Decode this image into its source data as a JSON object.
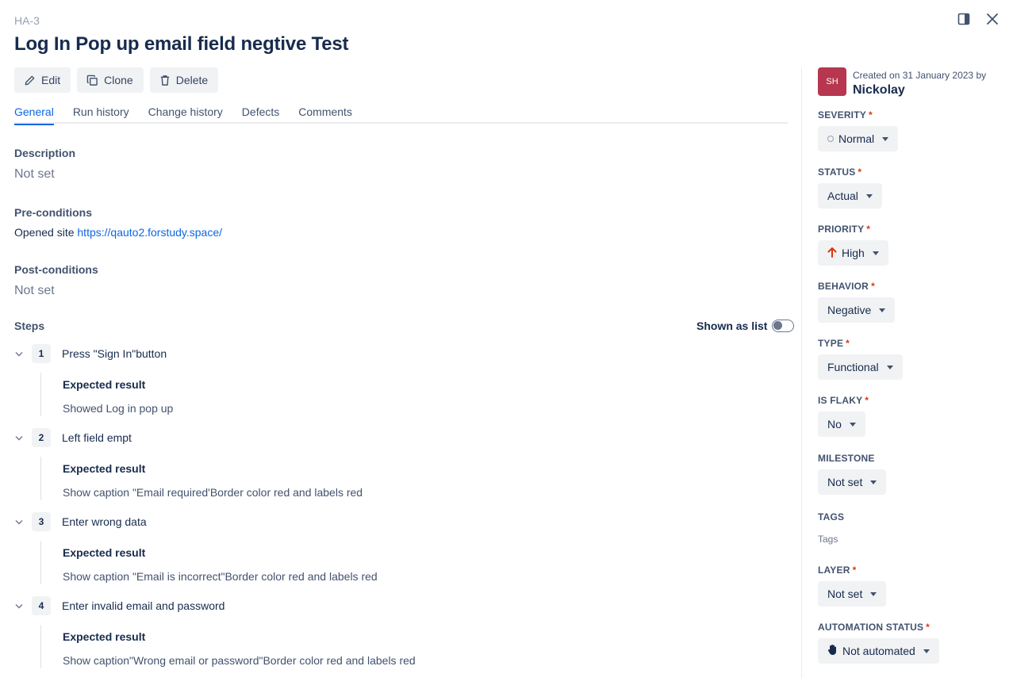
{
  "header": {
    "case_id": "HA-3",
    "title": "Log In Pop up email field negtive Test",
    "icons": [
      "panel-toggle-icon",
      "close-icon"
    ]
  },
  "toolbar": {
    "edit_label": "Edit",
    "clone_label": "Clone",
    "delete_label": "Delete"
  },
  "tabs": [
    {
      "label": "General",
      "active": true
    },
    {
      "label": "Run history",
      "active": false
    },
    {
      "label": "Change history",
      "active": false
    },
    {
      "label": "Defects",
      "active": false
    },
    {
      "label": "Comments",
      "active": false
    }
  ],
  "general": {
    "description_label": "Description",
    "description_value": "Not set",
    "preconditions_label": "Pre-conditions",
    "preconditions_text": "Opened site",
    "preconditions_link": "https://qauto2.forstudy.space/",
    "postconditions_label": "Post-conditions",
    "postconditions_value": "Not set",
    "steps_label": "Steps",
    "shown_as_list_label": "Shown as list",
    "shown_as_list_on": false
  },
  "steps": [
    {
      "number": "1",
      "action": "Press \"Sign In\"button",
      "expected_label": "Expected result",
      "expected": "Showed Log in pop up"
    },
    {
      "number": "2",
      "action": "Left field empt",
      "expected_label": "Expected result",
      "expected": "Show caption \"Email required'Border color red and labels red"
    },
    {
      "number": "3",
      "action": "Enter wrong data",
      "expected_label": "Expected result",
      "expected": "Show caption \"Email is incorrect\"Border color red and labels red"
    },
    {
      "number": "4",
      "action": "Enter invalid email and password",
      "expected_label": "Expected result",
      "expected": "Show caption\"Wrong email or password\"Border color red and labels red"
    }
  ],
  "sidebar": {
    "avatar_initials": "SH",
    "avatar_color": "#b6374f",
    "created_text": "Created on 31 January 2023 by",
    "created_by": "Nickolay",
    "severity": {
      "label": "Severity",
      "required": "*",
      "value": "Normal"
    },
    "status": {
      "label": "Status",
      "required": "*",
      "value": "Actual"
    },
    "priority": {
      "label": "Priority",
      "required": "*",
      "value": "High",
      "icon": "arrow-up-icon",
      "icon_color": "#de350b"
    },
    "behavior": {
      "label": "Behavior",
      "required": "*",
      "value": "Negative"
    },
    "type": {
      "label": "Type",
      "required": "*",
      "value": "Functional"
    },
    "is_flaky": {
      "label": "Is Flaky",
      "required": "*",
      "value": "No"
    },
    "milestone": {
      "label": "Milestone",
      "value": "Not set"
    },
    "tags": {
      "label": "Tags",
      "placeholder": "Tags"
    },
    "layer": {
      "label": "Layer",
      "required": "*",
      "value": "Not set"
    },
    "automation_status": {
      "label": "Automation status",
      "required": "*",
      "value": "Not automated",
      "icon": "hand-icon"
    }
  },
  "colors": {
    "accent": "#0c66e4",
    "required": "#de350b",
    "text_primary": "#172b4d",
    "button_bg": "#f1f2f4"
  }
}
